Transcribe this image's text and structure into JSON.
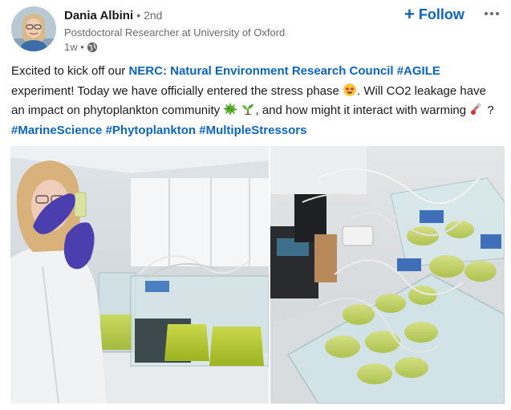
{
  "author": {
    "name": "Dania Albini",
    "degree": "• 2nd",
    "headline": "Postdoctoral Researcher at University of Oxford",
    "time": "1w •",
    "visibility_icon": "globe-icon"
  },
  "actions": {
    "follow_label": "Follow",
    "more_icon": "ellipsis-icon"
  },
  "post": {
    "t1": "Excited to kick off our ",
    "link_nerc": "NERC: Natural Environment Research Council",
    "t2": " ",
    "tag_agile": "#AGILE",
    "t3": " experiment! Today we have officially entered the stress phase ",
    "t4": ". Will CO2 leakage have an impact on phytoplankton community ",
    "t5": ", and how might it interact with warming ",
    "t6": " ? ",
    "tag_marine": "#MarineScience",
    "t7": " ",
    "tag_phyto": "#Phytoplankton",
    "t8": " ",
    "tag_stress": "#MultipleStressors"
  },
  "colors": {
    "accent": "#0a66c2",
    "text": "#191919",
    "secondary": "#666666"
  },
  "images": [
    {
      "name": "researcher-holding-vial-photo"
    },
    {
      "name": "tanks-with-beakers-photo"
    }
  ]
}
